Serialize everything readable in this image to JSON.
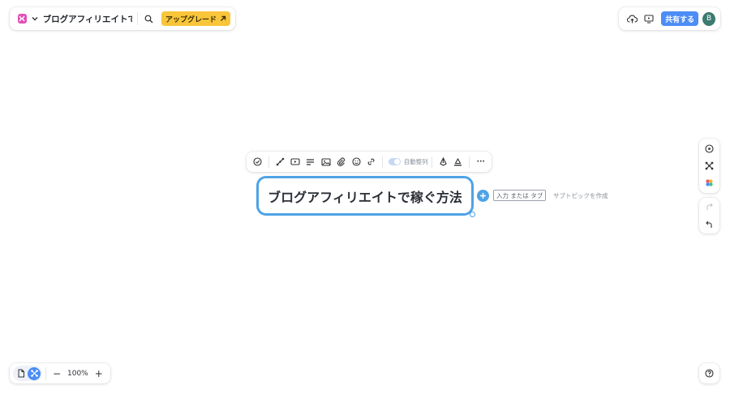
{
  "header": {
    "doc_title": "ブログアフィリエイトで稼ぐ...",
    "upgrade_label": "アップグレード",
    "share_label": "共有する",
    "avatar_initial": "B"
  },
  "toolbar": {
    "auto_layout_label": "自動整列",
    "more_label": "···"
  },
  "canvas": {
    "central_topic": "ブログアフィリエイトで稼ぐ方法",
    "key_hint": "入力 または タブ",
    "subtopic_hint": "サブトピックを作成"
  },
  "footer": {
    "zoom_level": "100%",
    "zoom_out": "−",
    "zoom_in": "+"
  },
  "colors": {
    "accent": "#4c8df6",
    "node_border": "#4ea3e6",
    "upgrade": "#f8c53b",
    "logo": "#e24fb6",
    "avatar": "#3d7a6f"
  },
  "icons": [
    "app-logo-icon",
    "chevron-down-icon",
    "search-icon",
    "arrow-up-right-icon",
    "cloud-upload-icon",
    "present-icon",
    "check-circle-icon",
    "branch-icon",
    "video-icon",
    "text-lines-icon",
    "image-icon",
    "paperclip-icon",
    "smile-icon",
    "link-icon",
    "pen-icon",
    "underline-icon",
    "add-circle-icon",
    "structure-icon",
    "palette-icon",
    "redo-icon",
    "undo-icon",
    "help-icon",
    "document-icon",
    "mindmap-icon"
  ]
}
